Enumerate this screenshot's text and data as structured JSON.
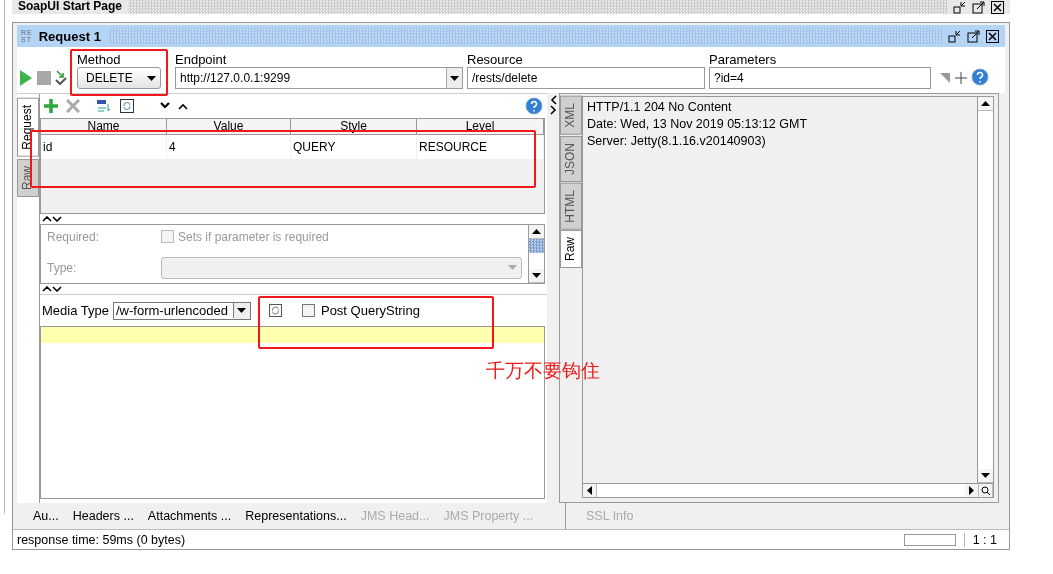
{
  "start_tab": {
    "title": "SoapUI Start Page"
  },
  "window": {
    "title": "Request 1",
    "badge_lines": [
      "RE",
      "ST"
    ]
  },
  "toolbar": {
    "method": {
      "label": "Method",
      "value": "DELETE"
    },
    "endpoint": {
      "label": "Endpoint",
      "value": "http://127.0.0.1:9299"
    },
    "resource": {
      "label": "Resource",
      "value": "/rests/delete"
    },
    "parameters": {
      "label": "Parameters",
      "value": "?id=4"
    }
  },
  "request_tabs": [
    {
      "label": "Request",
      "selected": true
    },
    {
      "label": "Raw",
      "selected": false
    }
  ],
  "params_table": {
    "columns": [
      "Name",
      "Value",
      "Style",
      "Level"
    ],
    "rows": [
      [
        "id",
        "4",
        "QUERY",
        "RESOURCE"
      ]
    ]
  },
  "detail": {
    "required_label": "Required:",
    "required_checkbox": {
      "label": "Sets if parameter is required",
      "checked": false
    },
    "type_label": "Type:"
  },
  "media": {
    "label": "Media Type",
    "value": "/w-form-urlencoded",
    "post_querystring": {
      "label": "Post QueryString",
      "checked": false
    }
  },
  "bottom_tabs": [
    {
      "label": "Au...",
      "disabled": false
    },
    {
      "label": "Headers ...",
      "disabled": false
    },
    {
      "label": "Attachments ...",
      "disabled": false
    },
    {
      "label": "Representations...",
      "disabled": false
    },
    {
      "label": "JMS Head...",
      "disabled": true
    },
    {
      "label": "JMS Property ...",
      "disabled": true
    }
  ],
  "response_tabs": [
    {
      "label": "XML",
      "selected": false
    },
    {
      "label": "JSON",
      "selected": false
    },
    {
      "label": "HTML",
      "selected": false
    },
    {
      "label": "Raw",
      "selected": true
    }
  ],
  "response_lines": [
    "HTTP/1.1 204 No Content",
    "Date: Wed, 13 Nov 2019 05:13:12 GMT",
    "Server: Jetty(8.1.16.v20140903)"
  ],
  "response_bottom_tabs": [
    {
      "label": "SSL Info",
      "disabled": true
    }
  ],
  "status": {
    "text": "response time: 59ms (0 bytes)",
    "position": "1 : 1"
  },
  "annotation": {
    "note": "千万不要钩住"
  }
}
